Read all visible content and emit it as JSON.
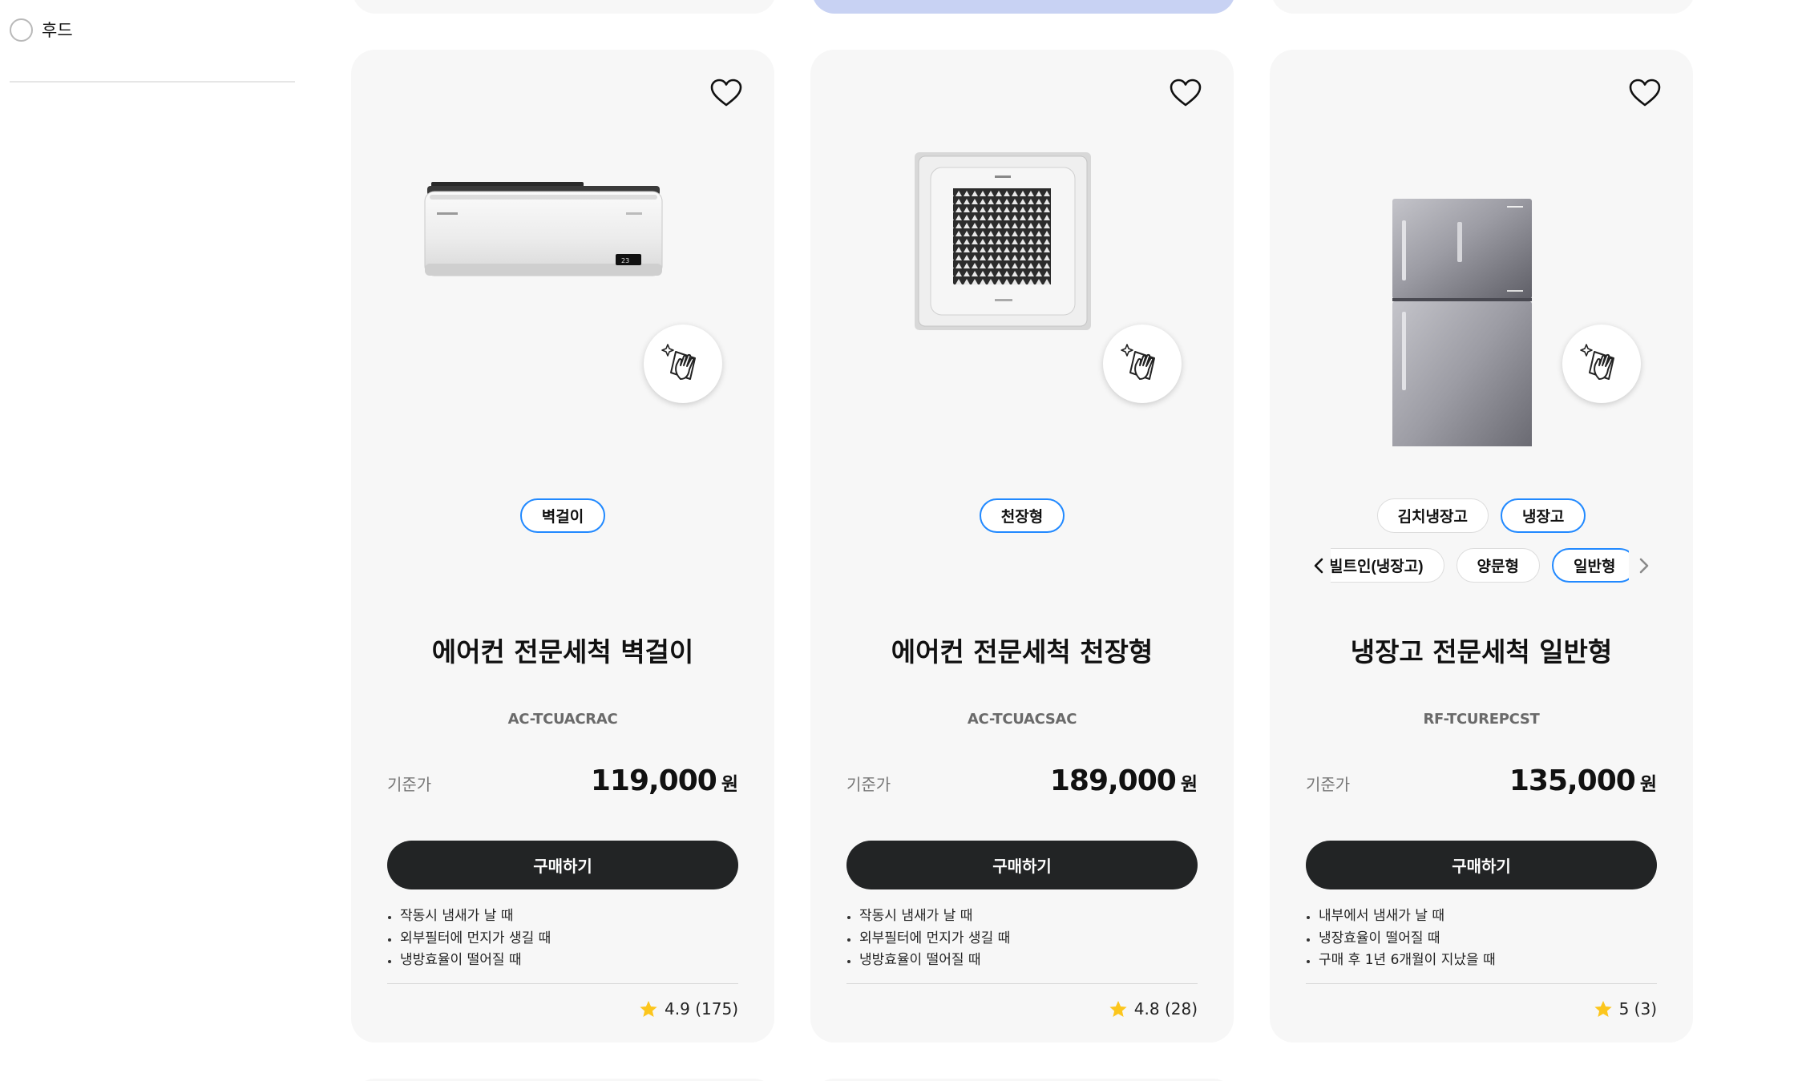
{
  "sidebar": {
    "filter_label": "후드"
  },
  "products": [
    {
      "title": "에어컨 전문세척 벽걸이",
      "model": "AC-TCUACRAC",
      "price_label": "기준가",
      "price": "119,000",
      "price_unit": "원",
      "buy_label": "구매하기",
      "chips": [
        "벽걸이"
      ],
      "selected_chip": "벽걸이",
      "bullets": [
        "작동시 냄새가 날 때",
        "외부필터에 먼지가 생길 때",
        "냉방효율이 떨어질 때"
      ],
      "rating": "4.9 (175)"
    },
    {
      "title": "에어컨 전문세척 천장형",
      "model": "AC-TCUACSAC",
      "price_label": "기준가",
      "price": "189,000",
      "price_unit": "원",
      "buy_label": "구매하기",
      "chips": [
        "천장형"
      ],
      "selected_chip": "천장형",
      "bullets": [
        "작동시 냄새가 날 때",
        "외부필터에 먼지가 생길 때",
        "냉방효율이 떨어질 때"
      ],
      "rating": "4.8 (28)"
    },
    {
      "title": "냉장고 전문세척 일반형",
      "model": "RF-TCUREPCST",
      "price_label": "기준가",
      "price": "135,000",
      "price_unit": "원",
      "buy_label": "구매하기",
      "chips": [
        "김치냉장고",
        "냉장고"
      ],
      "selected_chip": "냉장고",
      "sub_chips": [
        "빌트인(냉장고)",
        "양문형",
        "일반형"
      ],
      "selected_sub_chip": "일반형",
      "bullets": [
        "내부에서 냄새가 날 때",
        "냉장효율이 떨어질 때",
        "구매 후 1년 6개월이 지났을 때"
      ],
      "rating": "5 (3)"
    }
  ],
  "icons": {
    "wishlist": "heart-outline-icon",
    "clean_badge": "cleaning-hand-icon",
    "rating": "star-icon",
    "prev": "chevron-left-icon",
    "next": "chevron-right-icon"
  },
  "colors": {
    "accent": "#2189ff",
    "button": "#222425",
    "star": "#fcc61d",
    "card_bg": "#f7f7f7",
    "active_card_bg": "#c8d2f3"
  }
}
